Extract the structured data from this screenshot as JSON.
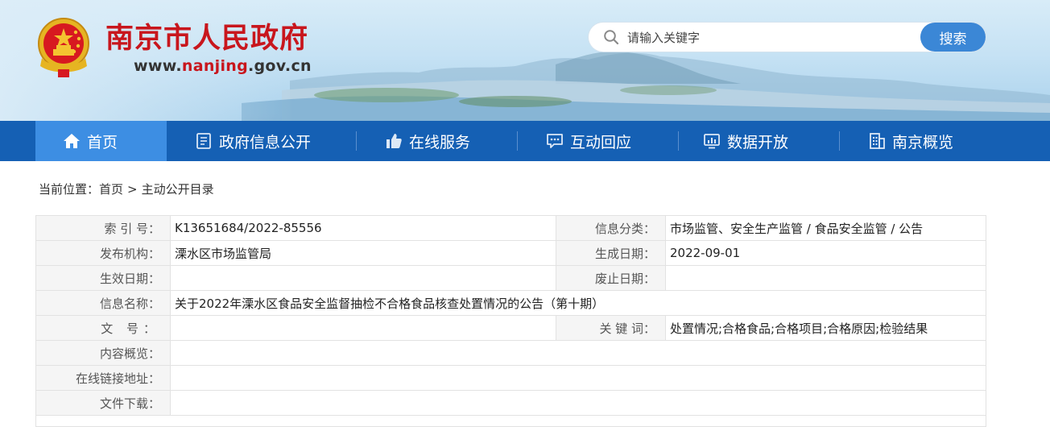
{
  "site": {
    "name": "南京市人民政府",
    "url_prefix": "www.",
    "url_highlight": "nanjing",
    "url_suffix": ".gov.cn"
  },
  "search": {
    "placeholder": "请输入关键字",
    "button_label": "搜索"
  },
  "nav": {
    "items": [
      {
        "label": "首页",
        "icon": "home-icon"
      },
      {
        "label": "政府信息公开",
        "icon": "document-icon"
      },
      {
        "label": "在线服务",
        "icon": "thumbs-up-icon"
      },
      {
        "label": "互动回应",
        "icon": "chat-icon"
      },
      {
        "label": "数据开放",
        "icon": "monitor-chart-icon"
      },
      {
        "label": "南京概览",
        "icon": "building-icon"
      }
    ],
    "active_index": 0
  },
  "breadcrumb": {
    "prefix": "当前位置：",
    "home": "首页",
    "separator": ">",
    "current": "主动公开目录"
  },
  "info": {
    "index_label": "索 引 号：",
    "index_value": "K13651684/2022-85556",
    "category_label": "信息分类：",
    "category_value": "市场监管、安全生产监管 / 食品安全监管 / 公告",
    "publisher_label": "发布机构：",
    "publisher_value": "溧水区市场监管局",
    "created_label": "生成日期：",
    "created_value": "2022-09-01",
    "effective_label": "生效日期：",
    "effective_value": "",
    "expired_label": "废止日期：",
    "expired_value": "",
    "title_label": "信息名称：",
    "title_value": "关于2022年溧水区食品安全监督抽检不合格食品核查处置情况的公告（第十期）",
    "docno_label": "文 号：",
    "docno_value": "",
    "keywords_label": "关 键 词：",
    "keywords_value": "处置情况;合格食品;合格项目;合格原因;检验结果",
    "summary_label": "内容概览：",
    "summary_value": "",
    "link_label": "在线链接地址：",
    "link_value": "",
    "download_label": "文件下载：",
    "download_value": ""
  },
  "colors": {
    "brand_red": "#c8161d",
    "nav_blue": "#1560b4",
    "nav_active": "#3d8ee3",
    "search_button": "#3b87d6"
  }
}
